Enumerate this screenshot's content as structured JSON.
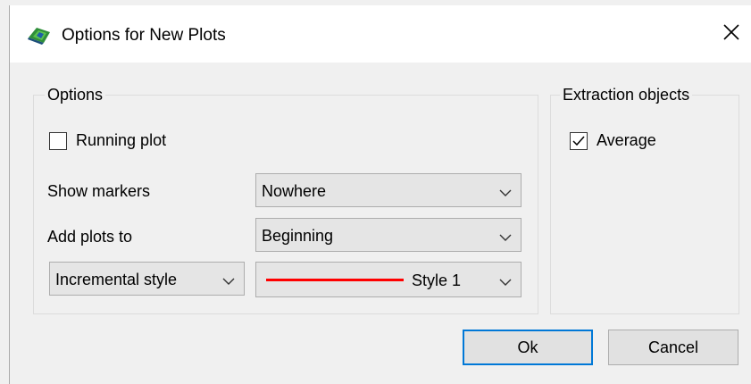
{
  "window": {
    "title": "Options for New Plots",
    "close_icon": "close-icon",
    "app_icon": "plot-app-icon"
  },
  "options_group": {
    "label": "Options",
    "running_plot": {
      "label": "Running plot",
      "checked": false
    },
    "show_markers": {
      "label": "Show markers",
      "value": "Nowhere"
    },
    "add_plots_to": {
      "label": "Add plots to",
      "value": "Beginning"
    },
    "incremental_style": {
      "value": "Incremental style"
    },
    "style": {
      "value": "Style 1",
      "line_color": "#ff0000"
    }
  },
  "extraction_group": {
    "label": "Extraction objects",
    "average": {
      "label": "Average",
      "checked": true
    }
  },
  "buttons": {
    "ok": "Ok",
    "cancel": "Cancel"
  },
  "colors": {
    "accent": "#0078d7",
    "background": "#f0f0f0",
    "titlebar": "#ffffff"
  }
}
